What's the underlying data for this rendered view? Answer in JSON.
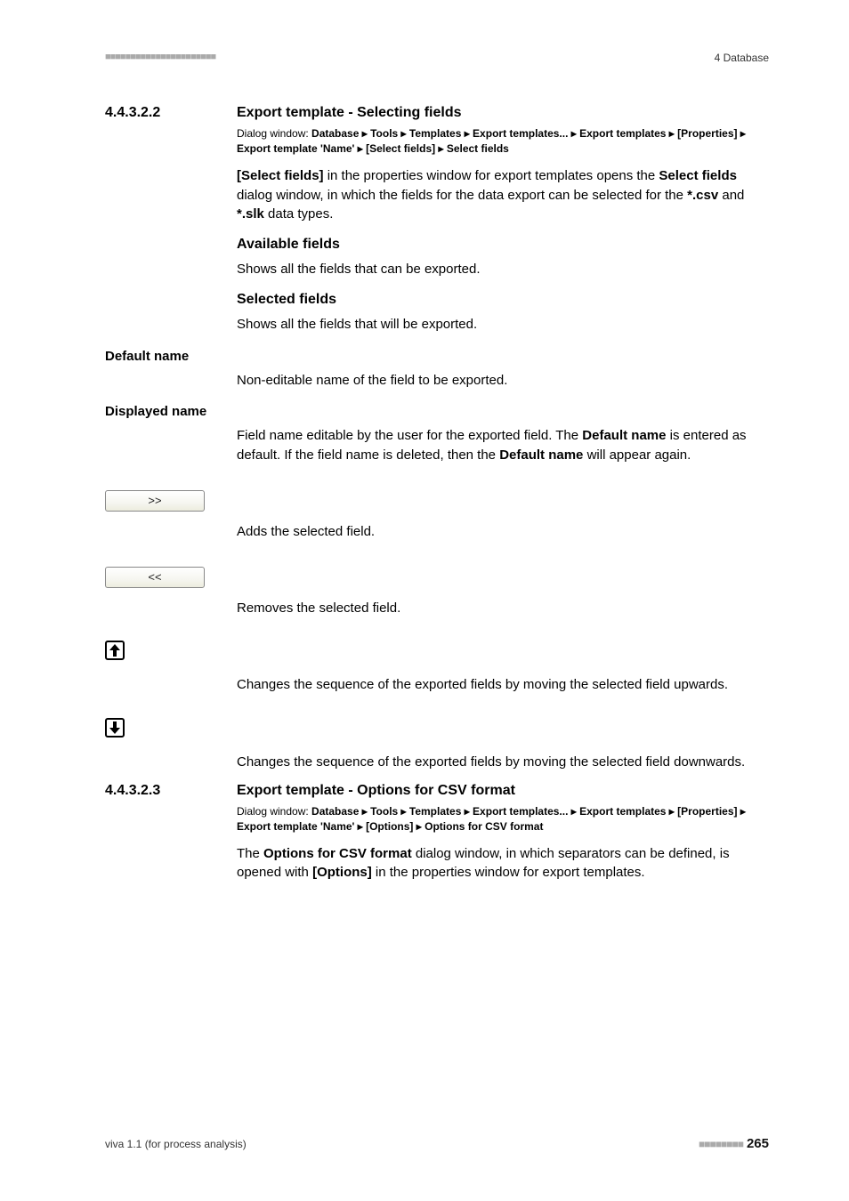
{
  "header": {
    "left_dots": "■■■■■■■■■■■■■■■■■■■■■■",
    "right": "4 Database"
  },
  "s1": {
    "num": "4.4.3.2.2",
    "title": "Export template - Selecting fields",
    "dialog": {
      "prefix": "Dialog window: ",
      "p1": "Database ▸ Tools ▸ Templates ▸ Export templates... ▸ Export templates ▸ [Properties] ▸ Export template 'Name' ▸ [Select fields] ▸ Select fields"
    },
    "intro_a": "[Select fields]",
    "intro_b": " in the properties window for export templates opens the ",
    "intro_c": "Select fields",
    "intro_d": " dialog window, in which the fields for the data export can be selected for the ",
    "intro_e": "*.csv",
    "intro_f": " and ",
    "intro_g": "*.slk",
    "intro_h": " data types.",
    "avail_h": "Available fields",
    "avail_p": "Shows all the fields that can be exported.",
    "sel_h": "Selected fields",
    "sel_p": "Shows all the fields that will be exported."
  },
  "default_name": {
    "label": "Default name",
    "desc": "Non-editable name of the field to be exported."
  },
  "displayed_name": {
    "label": "Displayed name",
    "desc_a": "Field name editable by the user for the exported field. The ",
    "dn1": "Default name",
    "desc_b": " is entered as default. If the field name is deleted, then the ",
    "dn2": "Default name",
    "desc_c": " will appear again."
  },
  "btns": {
    "add": ">>",
    "add_desc": "Adds the selected field.",
    "rem": "<<",
    "rem_desc": "Removes the selected field.",
    "up_desc": "Changes the sequence of the exported fields by moving the selected field upwards.",
    "down_desc": "Changes the sequence of the exported fields by moving the selected field downwards."
  },
  "s2": {
    "num": "4.4.3.2.3",
    "title": "Export template - Options for CSV format",
    "dialog": {
      "prefix": "Dialog window: ",
      "p1": "Database ▸ Tools ▸ Templates ▸ Export templates... ▸ Export templates ▸ [Properties] ▸ Export template 'Name' ▸ [Options] ▸ Options for CSV format"
    },
    "p_a": "The ",
    "p_b": "Options for CSV format",
    "p_c": " dialog window, in which separators can be defined, is opened with ",
    "p_d": "[Options]",
    "p_e": " in the properties window for export templates."
  },
  "footer": {
    "left": "viva 1.1 (for process analysis)",
    "dots": "■■■■■■■■",
    "page": "265"
  }
}
